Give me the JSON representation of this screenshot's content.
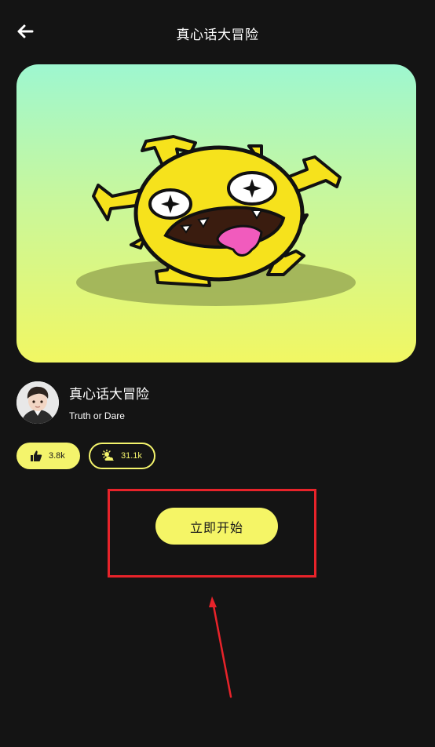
{
  "header": {
    "title": "真心话大冒险",
    "back_icon": "arrow-left-icon"
  },
  "hero": {
    "image_subject": "yellow-virus-monster-illustration",
    "gradient_top": "#9ef7d0",
    "gradient_bottom": "#f1f763"
  },
  "game": {
    "name": "真心话大冒险",
    "subtitle": "Truth or Dare",
    "avatar_icon": "avatar"
  },
  "stats": {
    "likes": "3.8k",
    "likes_icon": "thumbs-up-icon",
    "plays": "31.1k",
    "plays_icon": "sun-cloud-icon"
  },
  "actions": {
    "start_label": "立即开始"
  },
  "colors": {
    "background": "#141414",
    "accent": "#f5f566",
    "annotation": "#e8232a"
  }
}
